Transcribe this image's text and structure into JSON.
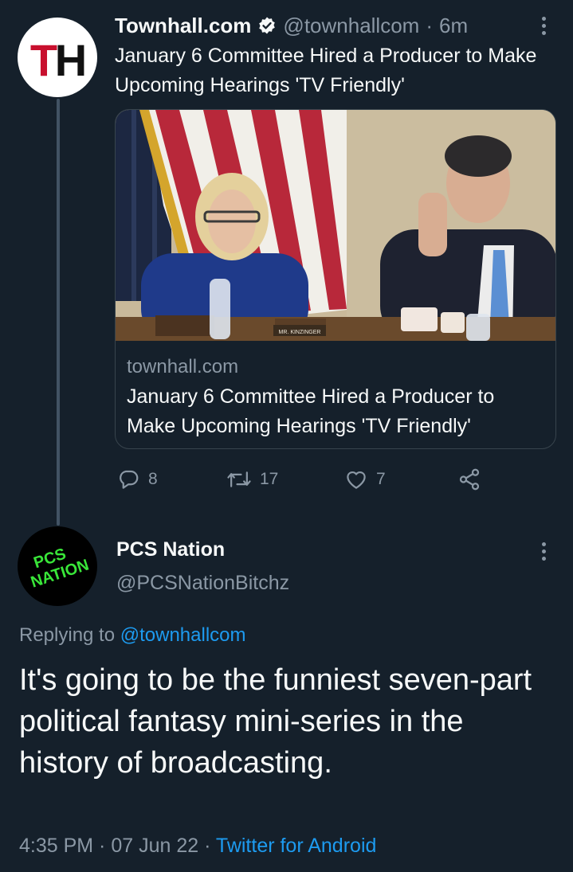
{
  "colors": {
    "background": "#15202b",
    "primary_text": "#f7f9f9",
    "secondary_text": "#8b98a5",
    "accent": "#1d9bf0",
    "thread_line": "#425364",
    "pcs_logo_green": "#39e639",
    "th_logo_red": "#c8102e"
  },
  "tweet1": {
    "avatar_initials": {
      "first": "T",
      "second": "H"
    },
    "display_name": "Townhall.com",
    "verified_icon": "verified-badge-icon",
    "handle": "@townhallcom",
    "separator": "·",
    "time": "6m",
    "text": "January 6 Committee Hired a Producer to Make Upcoming Hearings 'TV Friendly'",
    "card": {
      "image_placard_text": "MR. KINZINGER",
      "domain": "townhall.com",
      "title": "January 6 Committee Hired a Producer to Make Upcoming Hearings 'TV Friendly'"
    },
    "actions": {
      "reply": {
        "icon": "reply-bubble-icon",
        "count": "8"
      },
      "retweet": {
        "icon": "retweet-icon",
        "count": "17"
      },
      "like": {
        "icon": "heart-icon",
        "count": "7"
      },
      "share": {
        "icon": "share-icon"
      }
    }
  },
  "tweet2": {
    "avatar_logo": {
      "line1": "PCS",
      "line2": "NATION"
    },
    "display_name": "PCS Nation",
    "handle": "@PCSNationBitchz",
    "replying_prefix": "Replying to ",
    "replying_to": "@townhallcom",
    "text": "It's going to be the funniest seven-part political fantasy mini-series in the history of broadcasting.",
    "time": "4:35 PM",
    "separator1": " · ",
    "date": "07 Jun 22",
    "separator2": " · ",
    "source": "Twitter for Android"
  }
}
